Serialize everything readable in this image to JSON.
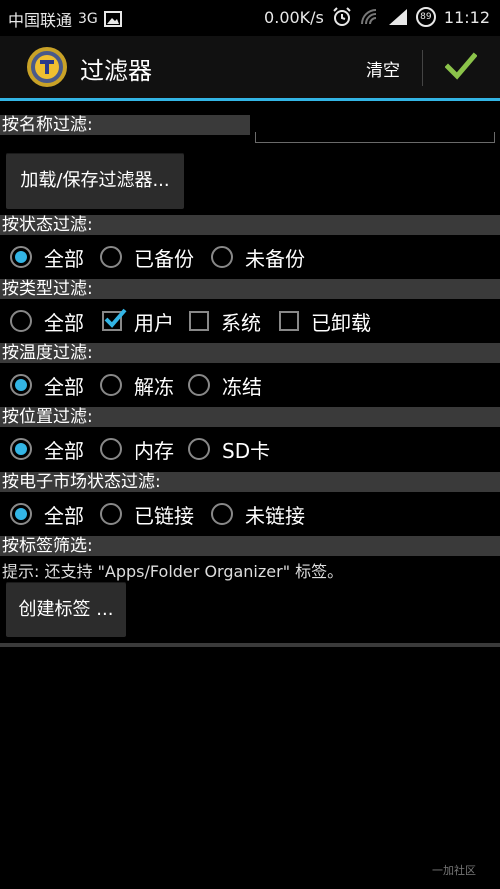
{
  "status_bar": {
    "carrier": "中国联通",
    "network": "3G",
    "speed": "0.00K/s",
    "battery": "89",
    "time": "11:12"
  },
  "action_bar": {
    "title": "过滤器",
    "clear_label": "清空",
    "confirm_icon": "check-icon",
    "accent_color": "#33b5e5",
    "check_color": "#8bc34a"
  },
  "filters": {
    "name": {
      "label": "按名称过滤:",
      "value": ""
    },
    "load_save_button": "加载/保存过滤器...",
    "status": {
      "label": "按状态过滤:",
      "options": [
        {
          "label": "全部",
          "selected": true
        },
        {
          "label": "已备份",
          "selected": false
        },
        {
          "label": "未备份",
          "selected": false
        }
      ]
    },
    "type": {
      "label": "按类型过滤:",
      "options": [
        {
          "label": "全部",
          "checked": false
        },
        {
          "label": "用户",
          "checked": true
        },
        {
          "label": "系统",
          "checked": false
        },
        {
          "label": "已卸载",
          "checked": false
        }
      ]
    },
    "temperature": {
      "label": "按温度过滤:",
      "options": [
        {
          "label": "全部",
          "selected": true
        },
        {
          "label": "解冻",
          "selected": false
        },
        {
          "label": "冻结",
          "selected": false
        }
      ]
    },
    "location": {
      "label": "按位置过滤:",
      "options": [
        {
          "label": "全部",
          "selected": true
        },
        {
          "label": "内存",
          "selected": false
        },
        {
          "label": "SD卡",
          "selected": false
        }
      ]
    },
    "market": {
      "label": "按电子市场状态过滤:",
      "options": [
        {
          "label": "全部",
          "selected": true
        },
        {
          "label": "已链接",
          "selected": false
        },
        {
          "label": "未链接",
          "selected": false
        }
      ]
    },
    "tags": {
      "label": "按标签筛选:",
      "hint": "提示: 还支持 \"Apps/Folder Organizer\" 标签。",
      "create_button": "创建标签 ..."
    }
  },
  "watermark": "一加社区"
}
